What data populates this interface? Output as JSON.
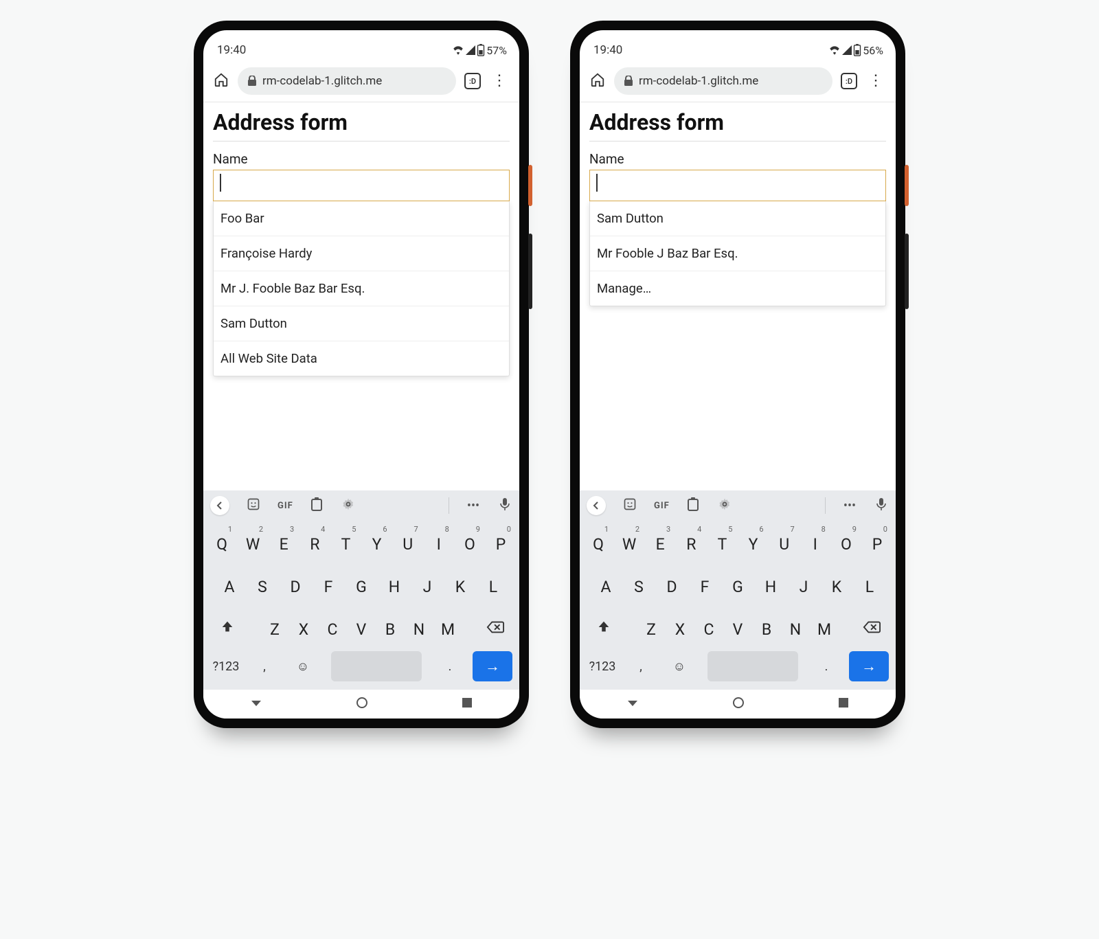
{
  "phones": [
    {
      "status": {
        "time": "19:40",
        "battery_pct": "57%"
      },
      "browser": {
        "url": "rm-codelab-1.glitch.me",
        "tabs": ":D"
      },
      "page": {
        "title": "Address form",
        "name_label": "Name",
        "name_value": "",
        "suggestions": [
          "Foo Bar",
          "Françoise Hardy",
          "Mr J. Fooble Baz Bar Esq.",
          "Sam Dutton",
          "All Web Site Data"
        ]
      }
    },
    {
      "status": {
        "time": "19:40",
        "battery_pct": "56%"
      },
      "browser": {
        "url": "rm-codelab-1.glitch.me",
        "tabs": ":D"
      },
      "page": {
        "title": "Address form",
        "name_label": "Name",
        "name_value": "",
        "suggestions": [
          "Sam Dutton",
          "Mr Fooble J Baz Bar Esq.",
          "Manage…"
        ]
      }
    }
  ],
  "keyboard": {
    "toolbar_gif": "GIF",
    "row1": [
      {
        "k": "Q",
        "n": "1"
      },
      {
        "k": "W",
        "n": "2"
      },
      {
        "k": "E",
        "n": "3"
      },
      {
        "k": "R",
        "n": "4"
      },
      {
        "k": "T",
        "n": "5"
      },
      {
        "k": "Y",
        "n": "6"
      },
      {
        "k": "U",
        "n": "7"
      },
      {
        "k": "I",
        "n": "8"
      },
      {
        "k": "O",
        "n": "9"
      },
      {
        "k": "P",
        "n": "0"
      }
    ],
    "row2": [
      "A",
      "S",
      "D",
      "F",
      "G",
      "H",
      "J",
      "K",
      "L"
    ],
    "row3": [
      "Z",
      "X",
      "C",
      "V",
      "B",
      "N",
      "M"
    ],
    "sym": "?123",
    "comma": ",",
    "period": "."
  }
}
